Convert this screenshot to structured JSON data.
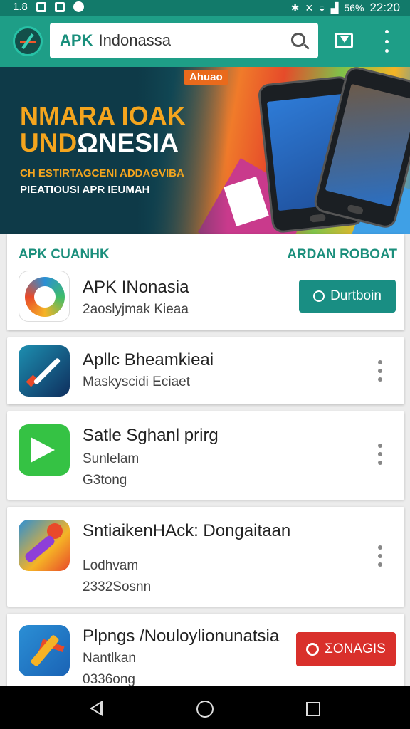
{
  "status_bar": {
    "left_text": "1.8",
    "time": "22:20",
    "battery": "56%"
  },
  "search": {
    "prefix": "APK",
    "query": "Indonassa"
  },
  "banner": {
    "badge": "Ahuao",
    "title_line1": "NMARA IOAK",
    "title_line2_a": "UND",
    "title_line2_b": "ΩNESIA",
    "sub1": "CH ESTIRTAGCENI ADDAGVIBA",
    "sub2": "PIEATIOUSI APR IEUMAH"
  },
  "featured": {
    "heading_left": "APK CUANHK",
    "heading_right": "ARDAN ROBOAT",
    "app": {
      "name": "APK INonasia",
      "subtitle": "2aoslyjmak Kieaa",
      "button": "Durtboin",
      "icon": "apk-logo-icon"
    }
  },
  "apps": [
    {
      "name": "Apllc Bheamkieai",
      "line1": "Maskyscidi Eciaet",
      "line2": "",
      "icon": "brush-icon"
    },
    {
      "name": "Satle Sghanl prirg",
      "line1": "Sunlelam",
      "line2": "G3tong",
      "icon": "green-play-icon"
    },
    {
      "name": "SntiaikenHAck: Dongaitaan",
      "line1": "Lodhvam",
      "line2": "2332Sosnn",
      "icon": "hack-tool-icon"
    },
    {
      "name": "Plpngs /Nouloylionunatsia",
      "line1": "Nantlkan",
      "line2": "0336ong",
      "icon": "arrow-app-icon",
      "button": "ΣΟΝΑGIS"
    }
  ],
  "colors": {
    "app_bar": "#1e9e87",
    "status_bar": "#127a6a",
    "accent": "#198e83",
    "danger": "#d9302b"
  }
}
